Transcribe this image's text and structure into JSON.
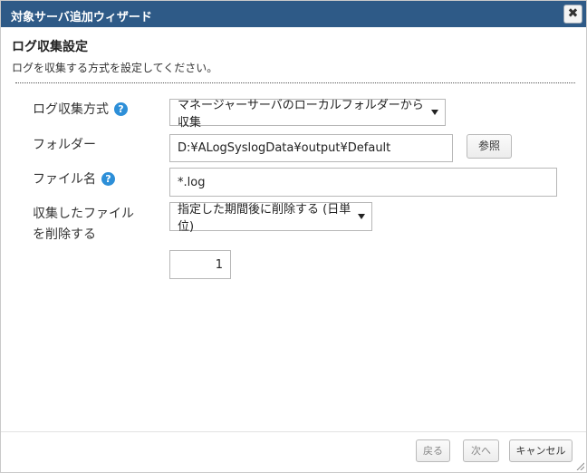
{
  "dialog": {
    "title": "対象サーバ追加ウィザード",
    "close_glyph": "✖"
  },
  "section": {
    "title": "ログ収集設定",
    "description": "ログを収集する方式を設定してください。"
  },
  "form": {
    "collection_method": {
      "label": "ログ収集方式",
      "value": "マネージャーサーバのローカルフォルダーから収集"
    },
    "folder": {
      "label": "フォルダー",
      "value": "D:¥ALogSyslogData¥output¥Default",
      "browse_label": "参照"
    },
    "file_name": {
      "label": "ファイル名",
      "value": "*.log"
    },
    "delete_collected": {
      "label_line1": "収集したファイル",
      "label_line2": "を削除する",
      "value": "指定した期間後に削除する (日単位)",
      "days": "1"
    },
    "help_glyph": "?"
  },
  "footer": {
    "back_label": "戻る",
    "next_label": "次へ",
    "cancel_label": "キャンセル"
  },
  "colors": {
    "titlebar": "#2e5a87",
    "help_icon": "#2d8fd8"
  }
}
